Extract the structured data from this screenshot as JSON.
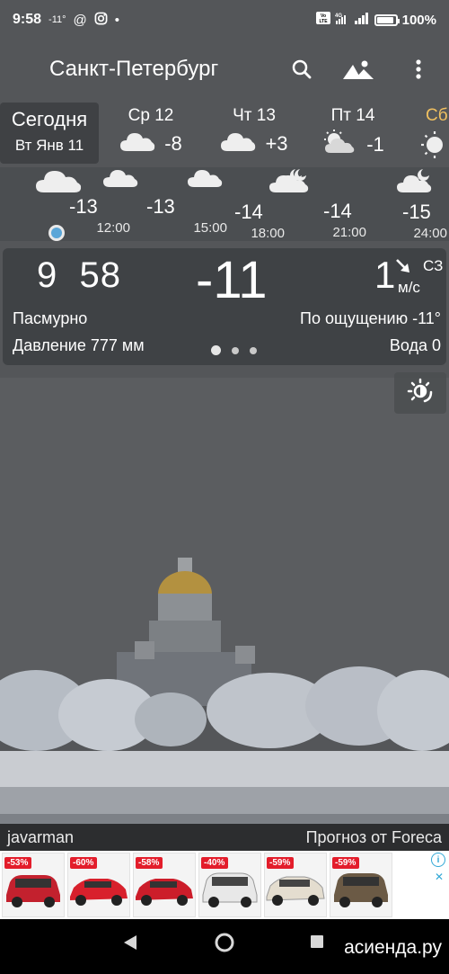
{
  "status_bar": {
    "time": "9:58",
    "temp_indicator": "-11°",
    "icons": [
      "at-sign-icon",
      "instagram-icon",
      "dot-icon",
      "volte-icon",
      "4g-signal-icon",
      "signal-icon",
      "battery-icon"
    ],
    "volte_label": "Vo LTE",
    "network_label": "4G",
    "battery_percent": "100%"
  },
  "app_bar": {
    "city": "Санкт-Петербург",
    "icons": [
      "search-icon",
      "landscape-icon",
      "more-vert-icon"
    ]
  },
  "days": {
    "today": {
      "label": "Сегодня",
      "date": "Вт Янв 11"
    },
    "items": [
      {
        "name": "Ср 12",
        "temp": "-8",
        "icon": "cloud-icon"
      },
      {
        "name": "Чт 13",
        "temp": "+3",
        "icon": "cloud-icon"
      },
      {
        "name": "Пт 14",
        "temp": "-1",
        "icon": "partly-cloudy-icon"
      },
      {
        "name": "Сб",
        "temp": "",
        "icon": "sun-icon"
      }
    ]
  },
  "hourly": [
    {
      "temp": "-13",
      "time": "12:00",
      "icon": "cloud-icon"
    },
    {
      "temp": "-13",
      "time": "15:00",
      "icon": "cloud-icon"
    },
    {
      "temp": "-14",
      "time": "18:00",
      "icon": "cloud-moon-icon"
    },
    {
      "temp": "-14",
      "time": "21:00",
      "icon": "cloud-moon-icon"
    },
    {
      "temp": "-15",
      "time": "24:00",
      "icon": "cloud-moon-icon"
    }
  ],
  "current": {
    "clock_hours": "9",
    "clock_minutes": "58",
    "temp": "-11",
    "wind_speed": "1",
    "wind_dir": "СЗ",
    "wind_unit": "м/с",
    "condition": "Пасмурно",
    "feels_like": "По ощущению -11°",
    "pressure": "Давление 777 мм",
    "water": "Вода 0",
    "page_dots": 3,
    "active_dot": 0
  },
  "photo": {
    "author": "javarman",
    "provider": "Прогноз от Foreca"
  },
  "ad": {
    "badges": [
      "-53%",
      "-60%",
      "-58%",
      "-40%",
      "-59%",
      "-59%"
    ],
    "info_label": "i",
    "close_label": "✕"
  },
  "nav_bar": {
    "icons": [
      "back-icon",
      "home-icon",
      "recents-icon"
    ],
    "watermark": "асиенда.ру"
  },
  "colors": {
    "accent_saturday": "#f0c060",
    "ad_badge": "#e31d2b"
  }
}
